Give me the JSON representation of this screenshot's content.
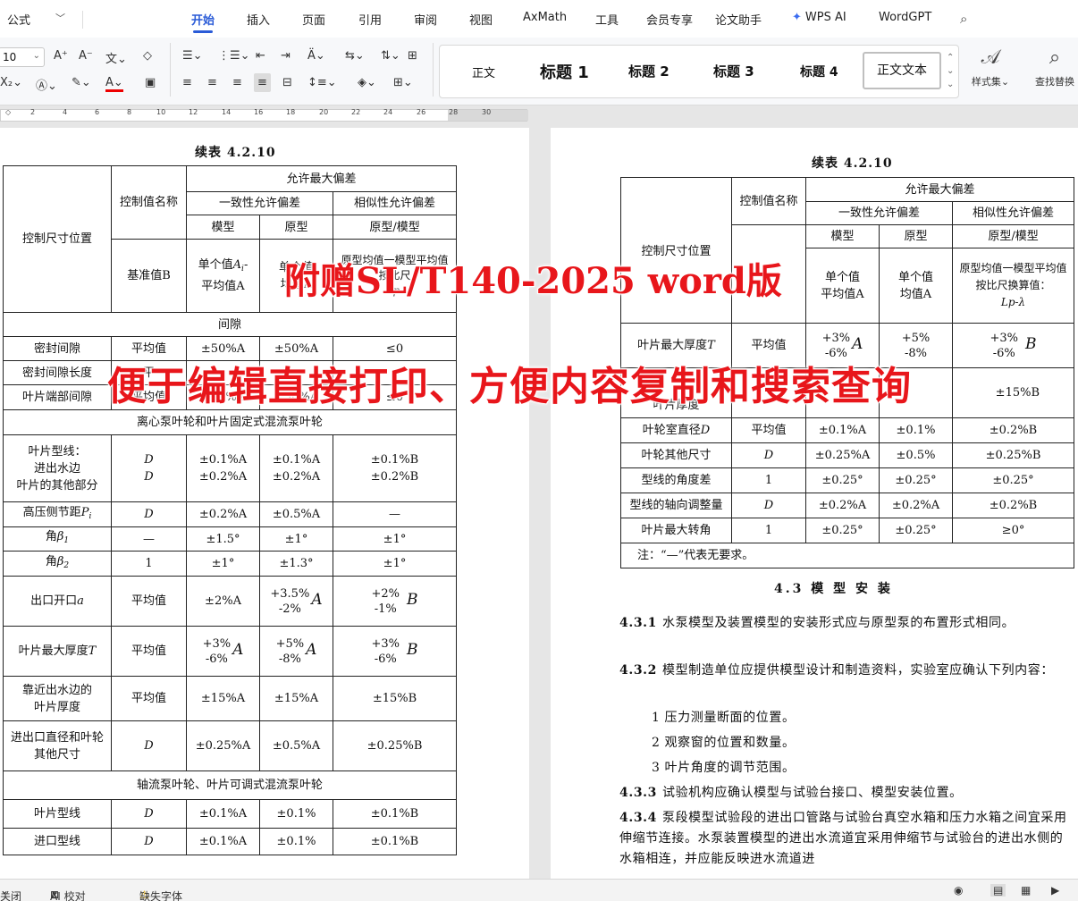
{
  "ribbon": {
    "font_name": "公式",
    "tabs": [
      "开始",
      "插入",
      "页面",
      "引用",
      "审阅",
      "视图",
      "AxMath",
      "工具",
      "会员专享",
      "论文助手",
      "WPS AI",
      "WordGPT"
    ],
    "font_size": "10",
    "styles": [
      "正文",
      "标题 1",
      "标题 2",
      "标题 3",
      "标题 4",
      "正文文本"
    ],
    "style_set_label": "样式集",
    "find_replace_label": "查找替换"
  },
  "ruler": {
    "ticks": [
      "2",
      "4",
      "6",
      "8",
      "10",
      "12",
      "14",
      "16",
      "18",
      "20",
      "22",
      "24",
      "26",
      "28",
      "30"
    ]
  },
  "left_page": {
    "caption": "续表 4.2.10",
    "header": {
      "position": "控制尺寸位置",
      "value_name": "控制值名称",
      "max_dev": "允许最大偏差",
      "consistency": "一致性允许偏差",
      "similarity": "相似性允许偏差",
      "model": "模型",
      "prototype": "原型",
      "proto_model": "原型/模型",
      "base_value": "基准值B",
      "single_model_1": "单个值",
      "single_model_2": "A",
      "single_model_3": "i",
      "single_model_4": "-",
      "single_model_5": "平均值A",
      "single_proto_1": "单个值",
      "single_proto_2": "均值A",
      "proto_avg_1": "原型均值一模型平均值",
      "proto_avg_2": "按比尺",
      "proto_avg_3": "Lp-"
    },
    "rows": {
      "gap": "间隙",
      "seal_gap": {
        "name": "密封间隙",
        "value": "平均值",
        "model": "±50%A",
        "proto": "±50%A",
        "sim": "≤0"
      },
      "seal_len": {
        "name": "密封间隙长度",
        "value": "平",
        "model": "",
        "proto": "",
        "sim": ""
      },
      "tip_gap": {
        "name": "叶片端部间隙",
        "value": "平均值",
        "model": "±50%A",
        "proto": "±50%A",
        "sim": "≤0"
      },
      "centrifugal": "离心泵叶轮和叶片固定式混流泵叶轮",
      "blade_profile": {
        "name1": "叶片型线：",
        "name2": "进出水边",
        "name3": "叶片的其他部分",
        "value1": "D",
        "value2": "D",
        "model1": "±0.1%A",
        "model2": "±0.2%A",
        "proto1": "±0.1%A",
        "proto2": "±0.2%A",
        "sim1": "±0.1%B",
        "sim2": "±0.2%B"
      },
      "hp_pitch": {
        "name": "高压侧节距",
        "sym": "P",
        "sub": "i",
        "value": "D",
        "model": "±0.2%A",
        "proto": "±0.5%A",
        "sim": "—"
      },
      "angle1": {
        "name": "角",
        "sym": "β",
        "sub": "1",
        "value": "—",
        "model": "±1.5°",
        "proto": "±1°",
        "sim": "±1°"
      },
      "angle2": {
        "name": "角",
        "sym": "β",
        "sub": "2",
        "value": "1",
        "model": "±1°",
        "proto": "±1.3°",
        "sim": "±1°"
      },
      "outlet": {
        "name": "出口开口",
        "sym": "a",
        "value": "平均值",
        "model": "±2%A",
        "proto_top": "+3.5%",
        "proto_bot": "-2%",
        "sim_top": "+2%",
        "sim_bot": "-1%",
        "letterA": "A",
        "letterB": "B"
      },
      "thick": {
        "name": "叶片最大厚度",
        "sym": "T",
        "value": "平均值",
        "model_top": "+3%",
        "model_bot": "-6%",
        "proto_top": "+5%",
        "proto_bot": "-8%",
        "sim_top": "+3%",
        "sim_bot": "-6%"
      },
      "near_edge": {
        "name1": "靠近出水边的",
        "name2": "叶片厚度",
        "value": "平均值",
        "model": "±15%A",
        "proto": "±15%A",
        "sim": "±15%B"
      },
      "diameter": {
        "name1": "进出口直径和叶轮",
        "name2": "其他尺寸",
        "value": "D",
        "model": "±0.25%A",
        "proto": "±0.5%A",
        "sim": "±0.25%B"
      },
      "axial": "轴流泵叶轮、叶片可调式混流泵叶轮",
      "blade_line": {
        "name": "叶片型线",
        "value": "D",
        "model": "±0.1%A",
        "proto": "±0.1%",
        "sim": "±0.1%B"
      },
      "inlet_line": {
        "name": "进口型线",
        "value": "D",
        "model": "±0.1%A",
        "proto": "±0.1%",
        "sim": "±0.1%B"
      }
    }
  },
  "right_page": {
    "caption": "续表 4.2.10",
    "header": {
      "position": "控制尺寸位置",
      "value_name": "控制值名称",
      "max_dev": "允许最大偏差",
      "consistency": "一致性允许偏差",
      "similarity": "相似性允许偏差",
      "model": "模型",
      "prototype": "原型",
      "proto_model": "原型/模型",
      "single_model_1": "单个值",
      "single_model_2": "平均值A",
      "single_proto_1": "单个值",
      "single_proto_2": "均值A",
      "proto_avg_1": "原型均值一模型平均值",
      "proto_avg_2": "按比尺",
      "proto_avg_3": "换算值：",
      "proto_avg_4": "Lp-λ"
    },
    "rows": {
      "thick": {
        "name": "叶片最大厚度",
        "sym": "T",
        "value": "平均值",
        "model_top": "+3%",
        "model_bot": "-6%",
        "proto_top": "+5%",
        "proto_bot": "-8%",
        "sim_top": "+3%",
        "sim_bot": "-6%"
      },
      "near_edge": {
        "name": "叶片厚度",
        "sim": "±15%B"
      },
      "hub": {
        "name": "叶轮室直径",
        "sym": "D",
        "value": "平均值",
        "model": "±0.1%A",
        "proto": "±0.1%",
        "sim": "±0.2%B"
      },
      "impeller_other": {
        "name": "叶轮其他尺寸",
        "value": "D",
        "model": "±0.25%A",
        "proto": "±0.5%",
        "sim": "±0.25%B"
      },
      "profile_angle": {
        "name": "型线的角度差",
        "value": "1",
        "model": "±0.25°",
        "proto": "±0.25°",
        "sim": "±0.25°"
      },
      "axial_adj": {
        "name": "型线的轴向调整量",
        "value": "D",
        "model": "±0.2%A",
        "proto": "±0.2%A",
        "sim": "±0.2%B"
      },
      "max_rot": {
        "name": "叶片最大转角",
        "value": "1",
        "model": "±0.25°",
        "proto": "±0.25°",
        "sim": "≥0°"
      },
      "note": "注：“—”代表无要求。"
    },
    "section_title": "4.3 模 型 安 装",
    "paras": [
      {
        "num": "4.3.1",
        "text": "水泵模型及装置模型的安装形式应与原型泵的布置形式相同。"
      },
      {
        "num": "4.3.2",
        "text": "模型制造单位应提供模型设计和制造资料，实验室应确认下列内容："
      },
      {
        "num": "4.3.3",
        "text": "试验机构应确认模型与试验台接口、模型安装位置。"
      },
      {
        "num": "4.3.4",
        "text": "泵段模型试验段的进出口管路与试验台真空水箱和压力水箱之间宜采用伸缩节连接。水泵装置模型的进出水流道宜采用伸缩节与试验台的进出水侧的水箱相连，并应能反映进水流道进"
      }
    ],
    "items": [
      "1 压力测量断面的位置。",
      "2 观察窗的位置和数量。",
      "3 叶片角度的调节范围。"
    ]
  },
  "overlay": {
    "line1": "附赠SL/T140-2025 word版",
    "line2": "便于编辑直接打印、方便内容复制和搜索查询"
  },
  "status": {
    "left": "关闭",
    "ai_check": "AI 校对",
    "missing_font": "缺失字体"
  }
}
